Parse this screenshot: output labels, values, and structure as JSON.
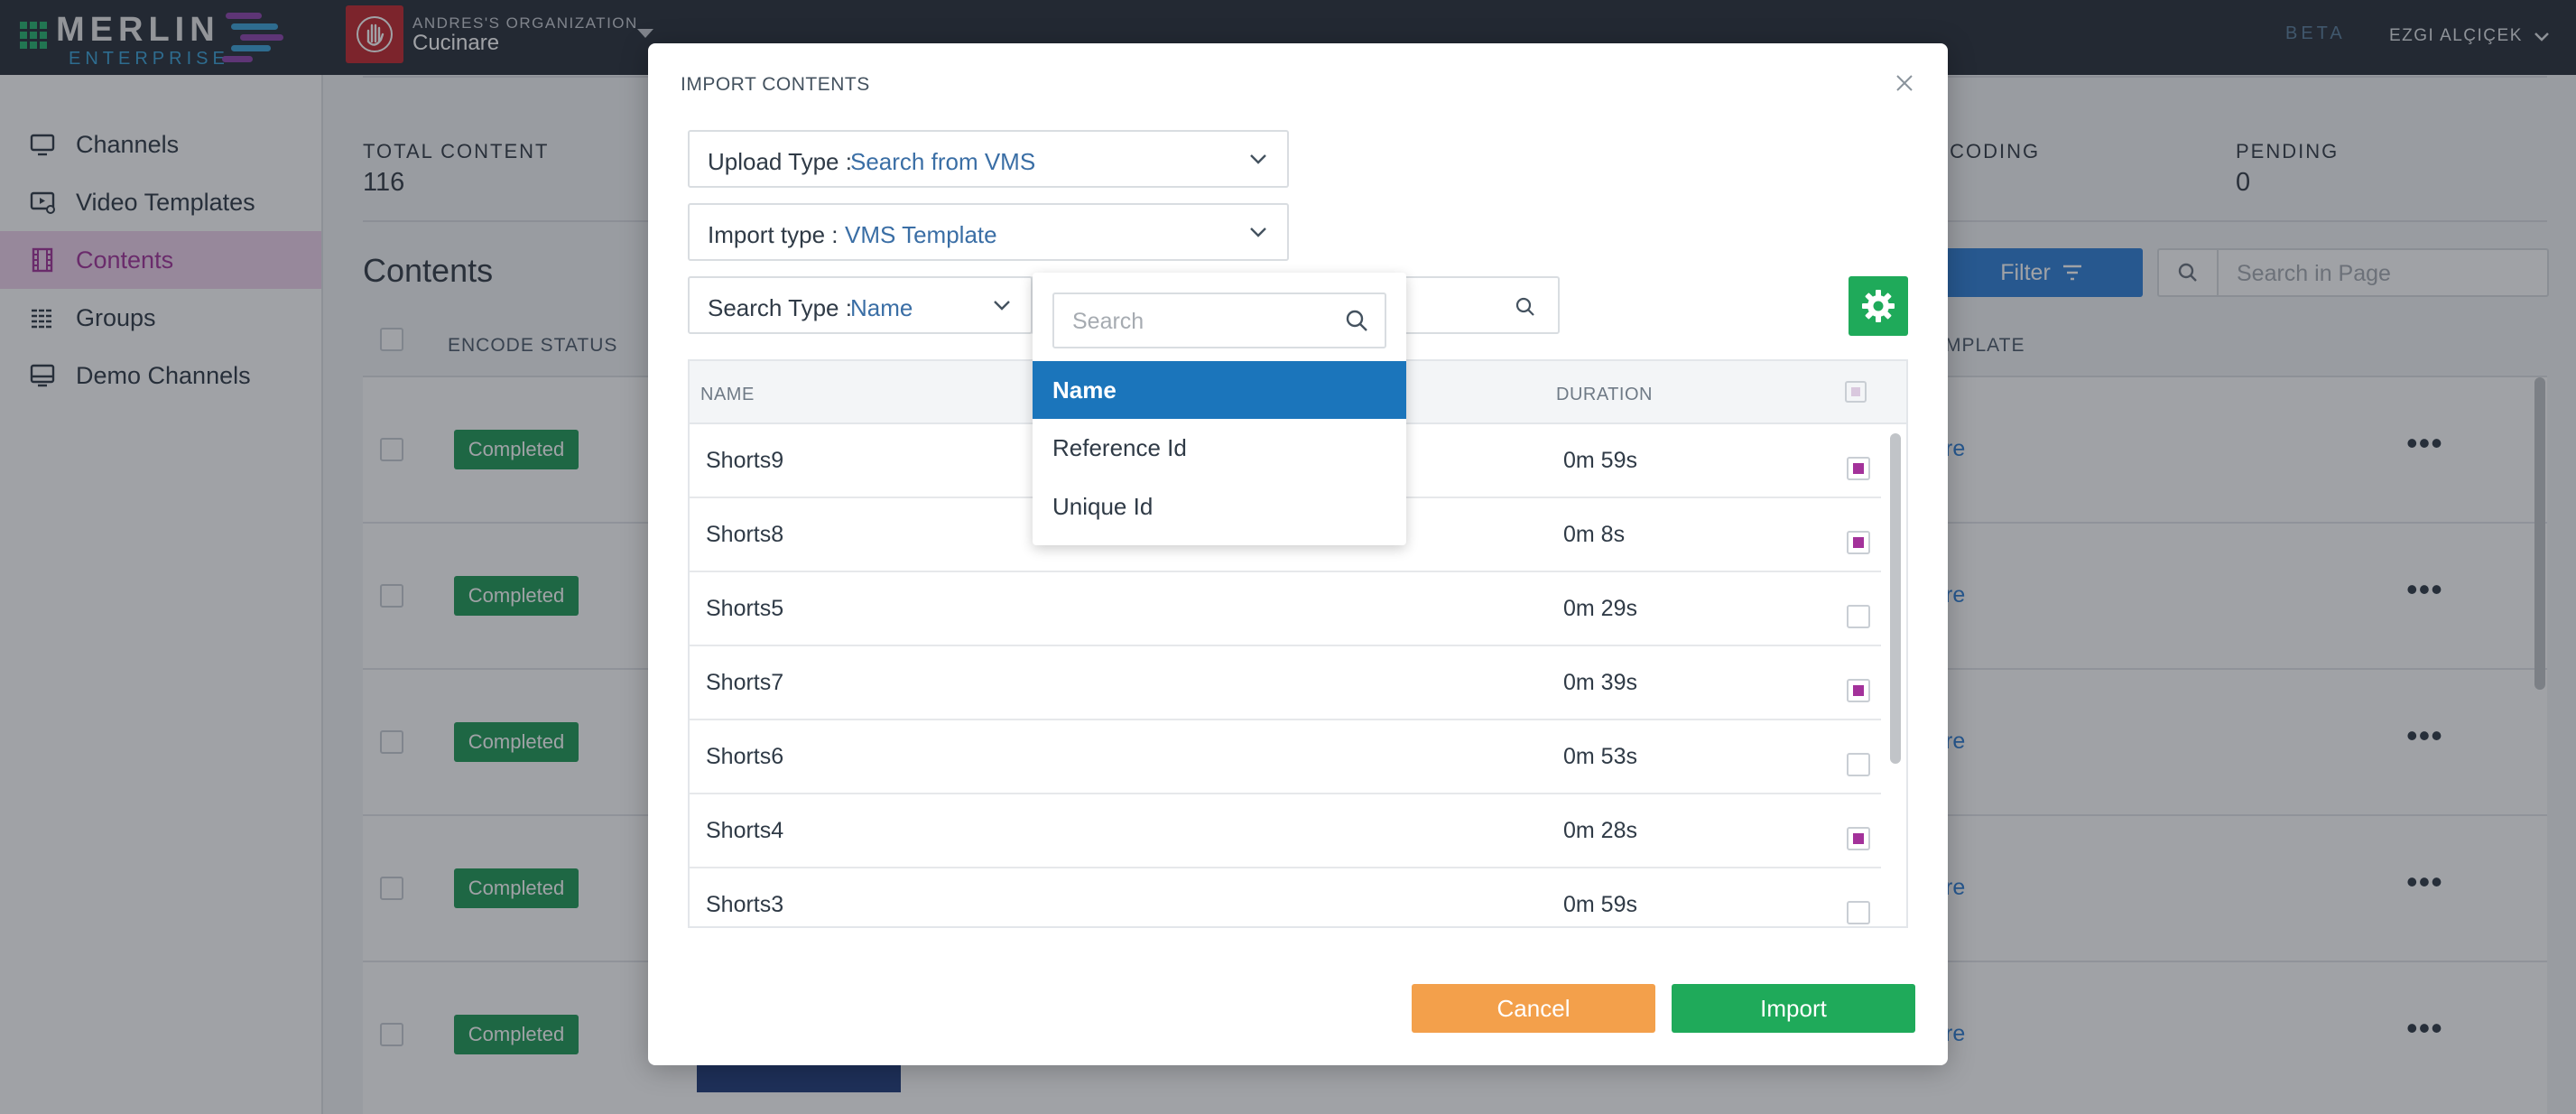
{
  "topbar": {
    "logo_main": "MERLIN",
    "logo_sub": "ENTERPRISE",
    "org_label": "ANDRES'S ORGANIZATION",
    "org_name": "Cucinare",
    "beta": "BETA",
    "user": "EZGI ALÇIÇEK"
  },
  "sidebar": {
    "items": [
      {
        "label": "Channels",
        "icon": "monitor-icon"
      },
      {
        "label": "Video Templates",
        "icon": "video-template-icon"
      },
      {
        "label": "Contents",
        "icon": "film-icon",
        "active": true
      },
      {
        "label": "Groups",
        "icon": "groups-icon"
      },
      {
        "label": "Demo Channels",
        "icon": "demo-monitor-icon"
      }
    ]
  },
  "stats": {
    "total_label": "TOTAL CONTENT",
    "total_value": "116",
    "encoding_label": "ICODING",
    "pending_label": "PENDING",
    "pending_value": "0"
  },
  "contents": {
    "title": "Contents",
    "filter_label": "Filter",
    "search_placeholder": "Search in Page",
    "col_encode": "ENCODE STATUS",
    "col_template": "MPLATE",
    "rows": [
      {
        "status": "Completed",
        "link": "re"
      },
      {
        "status": "Completed",
        "link": "re"
      },
      {
        "status": "Completed",
        "link": "re"
      },
      {
        "status": "Completed",
        "link": "re"
      },
      {
        "status": "Completed",
        "link": "re"
      }
    ],
    "more": "•••"
  },
  "modal": {
    "title": "IMPORT CONTENTS",
    "upload_type_label": "Upload Type :",
    "upload_type_value": "Search from VMS",
    "import_type_label": "Import type :",
    "import_type_value": "VMS Template",
    "search_type_label": "Search Type :",
    "search_type_value": "Name",
    "dropdown": {
      "placeholder": "Search",
      "options": [
        "Name",
        "Reference Id",
        "Unique Id"
      ],
      "selected": "Name"
    },
    "table": {
      "col_name": "NAME",
      "col_duration": "DURATION",
      "rows": [
        {
          "name": "Shorts9",
          "duration": "0m 59s",
          "checked": true
        },
        {
          "name": "Shorts8",
          "duration": "0m 8s",
          "checked": true
        },
        {
          "name": "Shorts5",
          "duration": "0m 29s",
          "checked": false
        },
        {
          "name": "Shorts7",
          "duration": "0m 39s",
          "checked": true
        },
        {
          "name": "Shorts6",
          "duration": "0m 53s",
          "checked": false
        },
        {
          "name": "Shorts4",
          "duration": "0m 28s",
          "checked": true
        },
        {
          "name": "Shorts3",
          "duration": "0m 59s",
          "checked": false
        }
      ]
    },
    "cancel_label": "Cancel",
    "import_label": "Import"
  },
  "colors": {
    "accent_purple": "#a3329a",
    "success_green": "#1faa5a",
    "primary_blue": "#2f80d8",
    "warning_orange": "#f3a04b",
    "topbar_bg": "#29303a"
  }
}
